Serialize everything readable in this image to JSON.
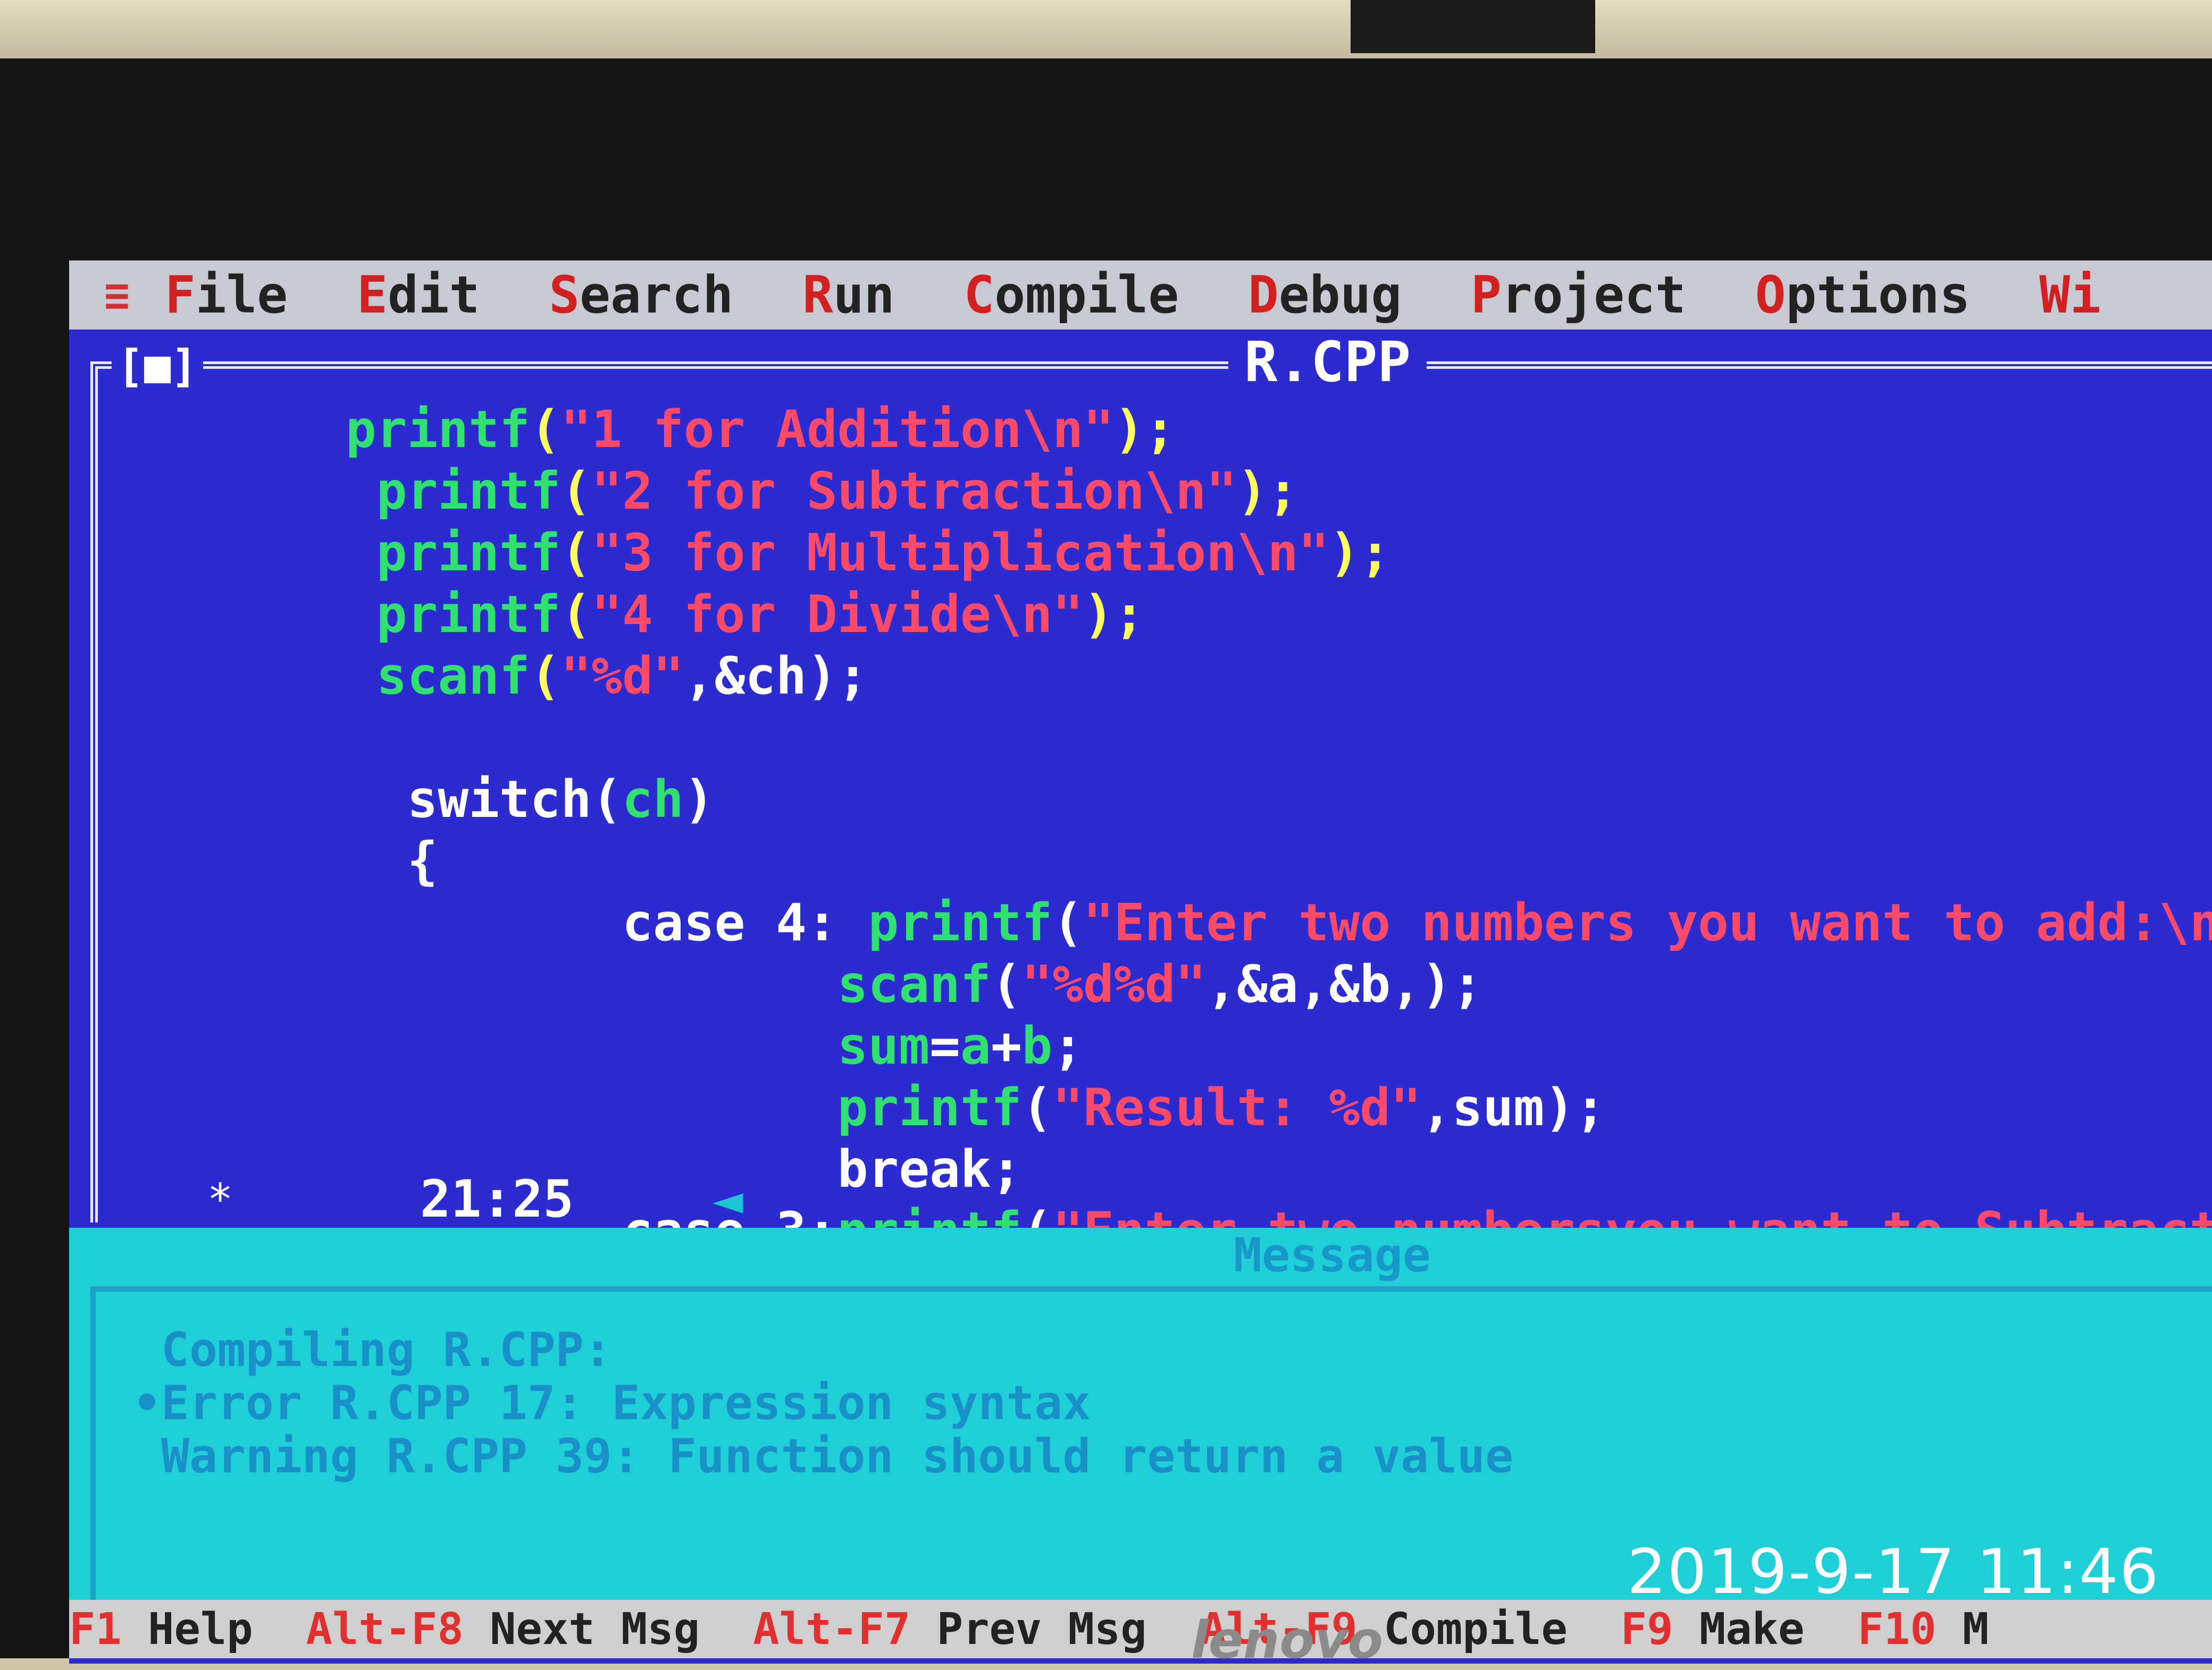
{
  "menu": {
    "system_icon": "≡",
    "items": [
      {
        "hot": "F",
        "rest": "ile"
      },
      {
        "hot": "E",
        "rest": "dit"
      },
      {
        "hot": "S",
        "rest": "earch"
      },
      {
        "hot": "R",
        "rest": "un"
      },
      {
        "hot": "C",
        "rest": "ompile"
      },
      {
        "hot": "D",
        "rest": "ebug"
      },
      {
        "hot": "P",
        "rest": "roject"
      },
      {
        "hot": "O",
        "rest": "ptions"
      },
      {
        "hot": "Wi",
        "rest": ""
      }
    ]
  },
  "editor": {
    "close_box": "[■]",
    "title": "R.CPP",
    "position": "21:25",
    "corner_marker": "*",
    "scroll_arrow": "◄",
    "code_lines": [
      [
        {
          "t": "printf",
          "c": "fn"
        },
        {
          "t": "(",
          "c": "pun"
        },
        {
          "t": "\"1 for Addition\\n\"",
          "c": "str"
        },
        {
          "t": ");",
          "c": "pun"
        }
      ],
      [
        {
          "t": " printf",
          "c": "fn"
        },
        {
          "t": "(",
          "c": "pun"
        },
        {
          "t": "\"2 for Subtraction\\n\"",
          "c": "str"
        },
        {
          "t": ");",
          "c": "pun"
        }
      ],
      [
        {
          "t": " printf",
          "c": "fn"
        },
        {
          "t": "(",
          "c": "pun"
        },
        {
          "t": "\"3 for Multiplication\\n\"",
          "c": "str"
        },
        {
          "t": ");",
          "c": "pun"
        }
      ],
      [
        {
          "t": " printf",
          "c": "fn"
        },
        {
          "t": "(",
          "c": "pun"
        },
        {
          "t": "\"4 for Divide\\n\"",
          "c": "str"
        },
        {
          "t": ");",
          "c": "pun"
        }
      ],
      [
        {
          "t": " scanf",
          "c": "fn"
        },
        {
          "t": "(",
          "c": "pun"
        },
        {
          "t": "\"%d\"",
          "c": "str"
        },
        {
          "t": ",&ch);",
          "c": "kw"
        }
      ],
      [],
      [
        {
          "t": "  switch(",
          "c": "kw"
        },
        {
          "t": "ch",
          "c": "fn"
        },
        {
          "t": ")",
          "c": "kw"
        }
      ],
      [
        {
          "t": "  {",
          "c": "kw"
        }
      ],
      [
        {
          "t": "         case 4: ",
          "c": "kw"
        },
        {
          "t": "printf",
          "c": "fn"
        },
        {
          "t": "(",
          "c": "kw"
        },
        {
          "t": "\"Enter two numbers you want to add:\\n\"",
          "c": "str"
        }
      ],
      [
        {
          "t": "                ",
          "c": "kw"
        },
        {
          "t": "scanf",
          "c": "fn"
        },
        {
          "t": "(",
          "c": "kw"
        },
        {
          "t": "\"%d%d\"",
          "c": "str"
        },
        {
          "t": ",&a,&b,);",
          "c": "kw"
        }
      ],
      [
        {
          "t": "                ",
          "c": "kw"
        },
        {
          "t": "sum",
          "c": "fn"
        },
        {
          "t": "=",
          "c": "kw"
        },
        {
          "t": "a",
          "c": "fn"
        },
        {
          "t": "+",
          "c": "kw"
        },
        {
          "t": "b",
          "c": "fn"
        },
        {
          "t": ";",
          "c": "kw"
        }
      ],
      [
        {
          "t": "                ",
          "c": "kw"
        },
        {
          "t": "printf",
          "c": "fn"
        },
        {
          "t": "(",
          "c": "kw"
        },
        {
          "t": "\"Result: %d\"",
          "c": "str"
        },
        {
          "t": ",sum);",
          "c": "kw"
        }
      ],
      [
        {
          "t": "                break;",
          "c": "kw"
        }
      ],
      [
        {
          "t": "         case 3:",
          "c": "kw"
        },
        {
          "t": "printf",
          "c": "fn"
        },
        {
          "t": "(",
          "c": "kw"
        },
        {
          "t": "\"Enter two numbersyou want to Subtract:\\n",
          "c": "str"
        }
      ]
    ]
  },
  "messages": {
    "title": "Message",
    "lines": [
      " Compiling R.CPP:",
      "•Error R.CPP 17: Expression syntax",
      " Warning R.CPP 39: Function should return a value"
    ]
  },
  "helpbar": {
    "entries": [
      {
        "key": "F1",
        "label": " Help"
      },
      {
        "key": "Alt-F8",
        "label": " Next Msg"
      },
      {
        "key": "Alt-F7",
        "label": " Prev Msg"
      },
      {
        "key": "Alt-F9",
        "label": " Compile"
      },
      {
        "key": "F9",
        "label": " Make"
      },
      {
        "key": "F10",
        "label": " M"
      }
    ]
  },
  "photo": {
    "timestamp": "2019-9-17 11:46",
    "brand": "lenovo"
  },
  "colors": {
    "editor_bg": "#2b2bd0",
    "message_bg": "#1fcfd8",
    "function": "#30e070",
    "string": "#ff4a6a"
  }
}
